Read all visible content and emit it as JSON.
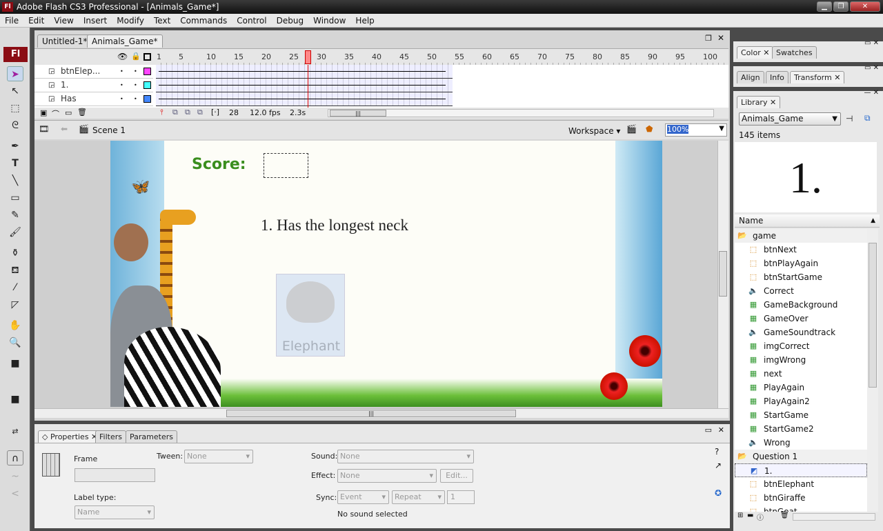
{
  "window": {
    "title": "Adobe Flash CS3 Professional - [Animals_Game*]",
    "logo": "Fl"
  },
  "menu": [
    "File",
    "Edit",
    "View",
    "Insert",
    "Modify",
    "Text",
    "Commands",
    "Control",
    "Debug",
    "Window",
    "Help"
  ],
  "toolbar": {
    "logo": "Fl"
  },
  "document": {
    "tabs": [
      "Untitled-1*",
      "Animals_Game*"
    ],
    "active_tab": 1
  },
  "timeline": {
    "frame_ticks": [
      "1",
      "5",
      "10",
      "15",
      "20",
      "25",
      "30",
      "35",
      "40",
      "45",
      "50",
      "55",
      "60",
      "65",
      "70",
      "75",
      "80",
      "85",
      "90",
      "95",
      "100"
    ],
    "layers": [
      {
        "name": "btnElep...",
        "color": "#ff44ff"
      },
      {
        "name": "1.",
        "color": "#44ffff"
      },
      {
        "name": "Has",
        "color": "#4488ff"
      }
    ],
    "current_frame": "28",
    "fps": "12.0 fps",
    "time": "2.3s",
    "playhead_frame": 28
  },
  "editbar": {
    "scene": "Scene 1",
    "workspace": "Workspace",
    "zoom": "100%"
  },
  "stage": {
    "score_label": "Score:",
    "question": "1. Has the longest neck",
    "button_label": "Elephant"
  },
  "properties": {
    "tabs": [
      "Properties",
      "Filters",
      "Parameters"
    ],
    "frame_label": "Frame",
    "frame_name": "",
    "tween_label": "Tween:",
    "tween_value": "None",
    "label_type_label": "Label type:",
    "label_type_value": "Name",
    "sound_label": "Sound:",
    "sound_value": "None",
    "effect_label": "Effect:",
    "effect_value": "None",
    "edit_button": "Edit...",
    "sync_label": "Sync:",
    "sync_value": "Event",
    "repeat_value": "Repeat",
    "repeat_count": "1",
    "status": "No sound selected"
  },
  "right_panels": {
    "color_tabs": [
      "Color",
      "Swatches"
    ],
    "align_tabs": [
      "Align",
      "Info",
      "Transform"
    ],
    "library": {
      "tab": "Library",
      "document": "Animals_Game",
      "count": "145 items",
      "preview": "1.",
      "column": "Name",
      "items": [
        {
          "name": "game",
          "type": "folder",
          "level": 0
        },
        {
          "name": "btnNext",
          "type": "button",
          "level": 1
        },
        {
          "name": "btnPlayAgain",
          "type": "button",
          "level": 1
        },
        {
          "name": "btnStartGame",
          "type": "button",
          "level": 1
        },
        {
          "name": "Correct",
          "type": "sound",
          "level": 1
        },
        {
          "name": "GameBackground",
          "type": "bitmap",
          "level": 1
        },
        {
          "name": "GameOver",
          "type": "bitmap",
          "level": 1
        },
        {
          "name": "GameSoundtrack",
          "type": "sound",
          "level": 1
        },
        {
          "name": "imgCorrect",
          "type": "bitmap",
          "level": 1
        },
        {
          "name": "imgWrong",
          "type": "bitmap",
          "level": 1
        },
        {
          "name": "next",
          "type": "bitmap",
          "level": 1
        },
        {
          "name": "PlayAgain",
          "type": "bitmap",
          "level": 1
        },
        {
          "name": "PlayAgain2",
          "type": "bitmap",
          "level": 1
        },
        {
          "name": "StartGame",
          "type": "bitmap",
          "level": 1
        },
        {
          "name": "StartGame2",
          "type": "bitmap",
          "level": 1
        },
        {
          "name": "Wrong",
          "type": "sound",
          "level": 1
        },
        {
          "name": "Question 1",
          "type": "folder",
          "level": 0
        },
        {
          "name": "1.",
          "type": "graphic",
          "level": 1,
          "selected": true
        },
        {
          "name": "btnElephant",
          "type": "button",
          "level": 1
        },
        {
          "name": "btnGiraffe",
          "type": "button",
          "level": 1
        },
        {
          "name": "btnGoat",
          "type": "button",
          "level": 1
        }
      ]
    }
  }
}
